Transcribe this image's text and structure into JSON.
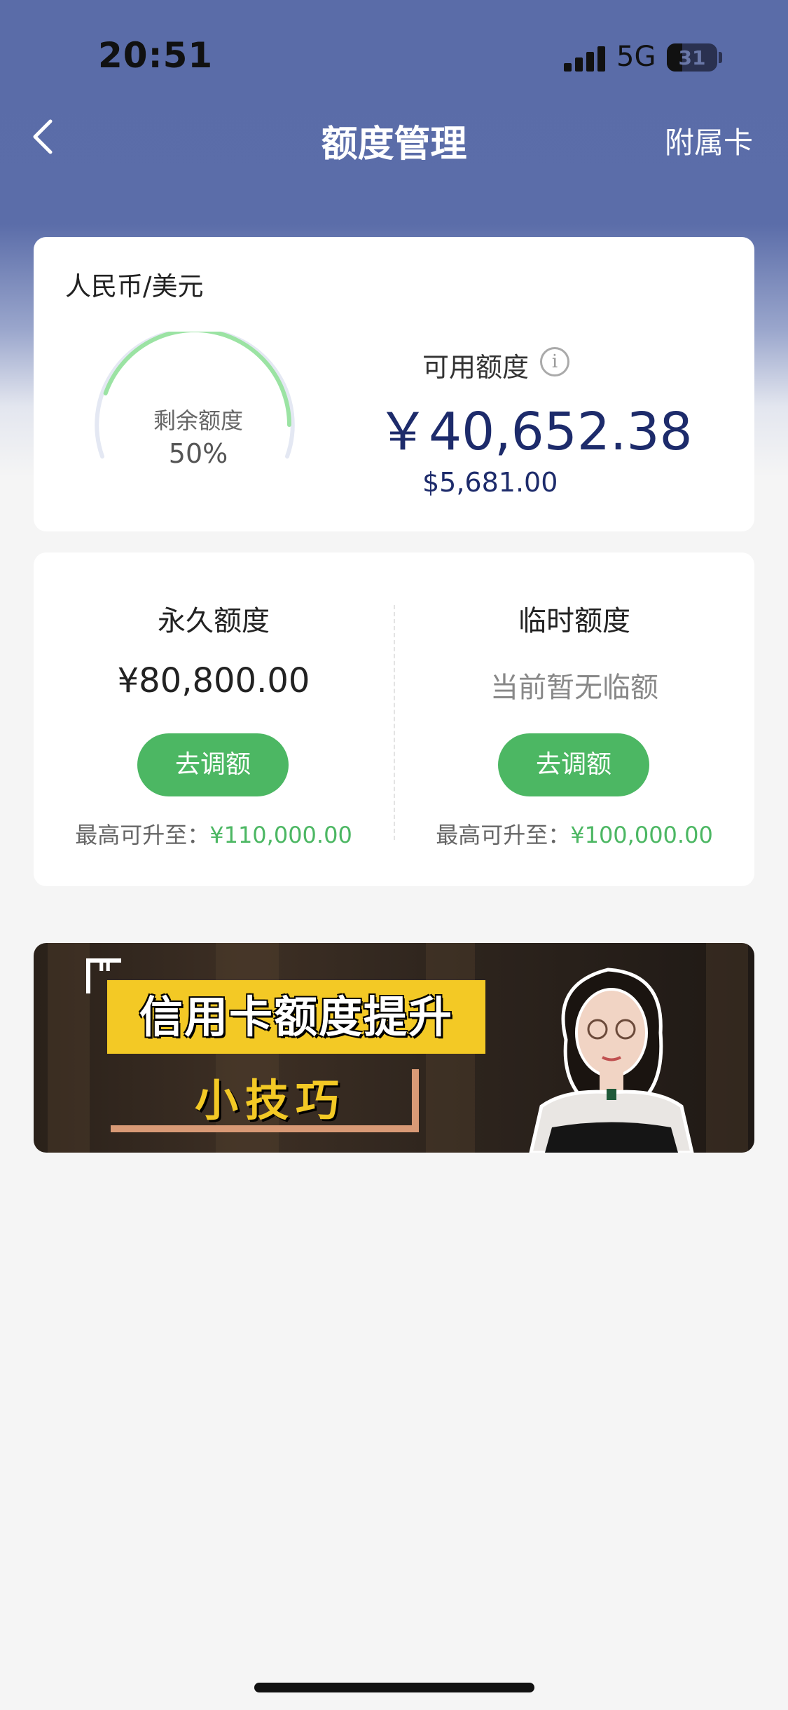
{
  "status_bar": {
    "time": "20:51",
    "network": "5G",
    "battery": "31"
  },
  "nav": {
    "title": "额度管理",
    "right_link": "附属卡",
    "back_icon": "chevron-left-icon"
  },
  "summary": {
    "currency_label": "人民币/美元",
    "gauge_label": "剩余额度",
    "gauge_percent_text": "50%",
    "gauge_fraction": 0.5,
    "available_label": "可用额度",
    "available_cny": "￥40,652.38",
    "available_usd": "$5,681.00"
  },
  "permanent": {
    "title": "永久额度",
    "value": "¥80,800.00",
    "button": "去调额",
    "max_prefix": "最高可升至：",
    "max_amount": "¥110,000.00"
  },
  "temporary": {
    "title": "临时额度",
    "value": "当前暂无临额",
    "button": "去调额",
    "max_prefix": "最高可升至：",
    "max_amount": "¥100,000.00"
  },
  "banner": {
    "line1": "信用卡额度提升",
    "line2": "小技巧"
  },
  "colors": {
    "header": "#5a6ca8",
    "accent_green": "#4cb763",
    "amount_navy": "#1d2b6b"
  }
}
